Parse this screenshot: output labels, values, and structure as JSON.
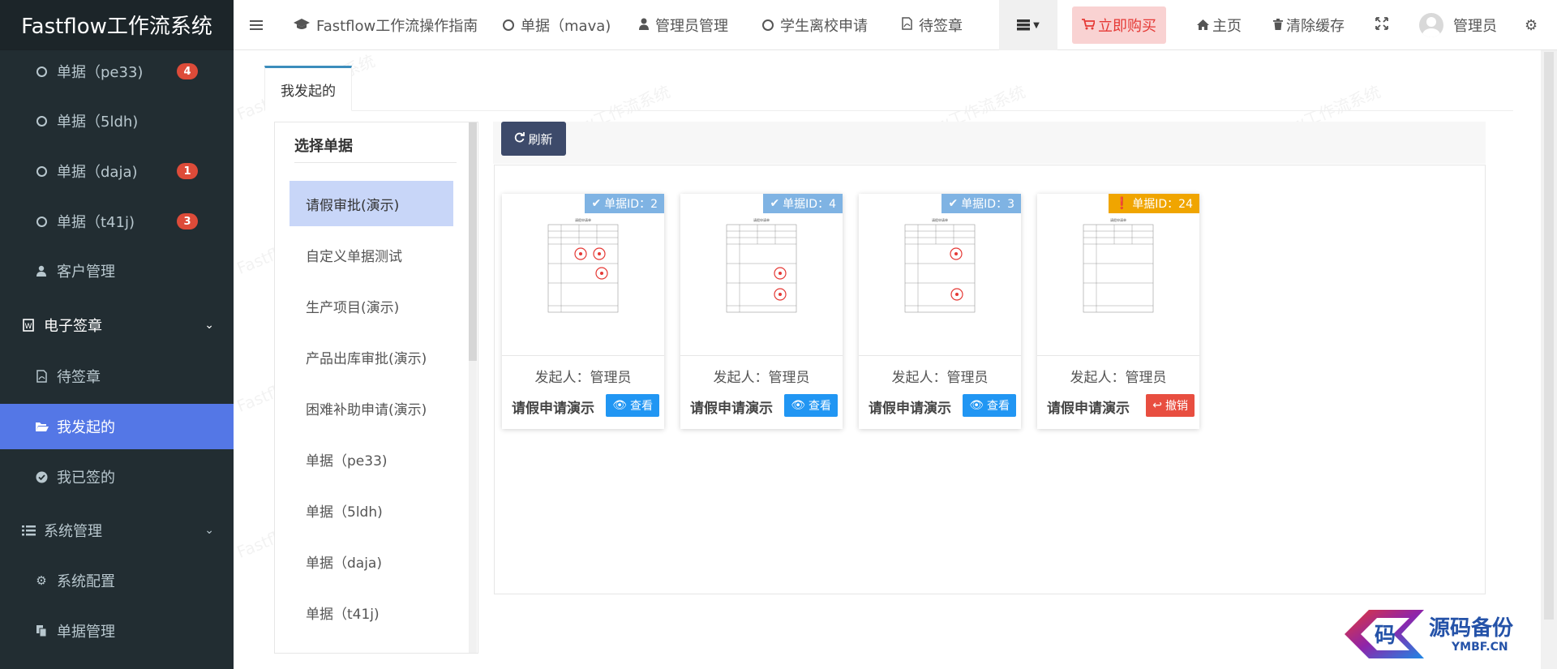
{
  "app": {
    "brand": "Fastflow工作流系统"
  },
  "sidebar": {
    "items": [
      {
        "label": "单据（pe33)",
        "badge": "4",
        "icon": "circle-icon"
      },
      {
        "label": "单据（5ldh)",
        "badge": "",
        "icon": "circle-icon"
      },
      {
        "label": "单据（daja)",
        "badge": "1",
        "icon": "circle-icon"
      },
      {
        "label": "单据（t41j)",
        "badge": "3",
        "icon": "circle-icon"
      },
      {
        "label": "客户管理",
        "icon": "user-icon"
      },
      {
        "label": "电子签章",
        "icon": "word-file-icon"
      },
      {
        "label": "待签章",
        "icon": "pdf-file-icon"
      },
      {
        "label": "我发起的",
        "icon": "folder-open-icon"
      },
      {
        "label": "我已签的",
        "icon": "check-circle-icon"
      },
      {
        "label": "系统管理",
        "icon": "list-icon"
      },
      {
        "label": "系统配置",
        "icon": "gear-icon"
      },
      {
        "label": "单据管理",
        "icon": "copy-icon"
      }
    ]
  },
  "topnav": {
    "guide": "Fastflow工作流操作指南",
    "mava": "单据（mava)",
    "admin_mgmt": "管理员管理",
    "leave_school": "学生离校申请",
    "pending_sign": "待签章",
    "buy": "立即购买",
    "home": "主页",
    "clear_cache": "清除缓存",
    "user": "管理员"
  },
  "tabs": {
    "active": "我发起的"
  },
  "left_panel": {
    "title": "选择单据",
    "categories": [
      "请假审批(演示)",
      "自定义单据测试",
      "生产项目(演示)",
      "产品出库审批(演示)",
      "困难补助申请(演示)",
      "单据（pe33)",
      "单据（5ldh)",
      "单据（daja)",
      "单据（t41j)"
    ]
  },
  "toolbar": {
    "refresh": "刷新"
  },
  "cards": [
    {
      "id_label": "单据ID：2",
      "starter": "发起人：管理员",
      "title": "请假申请演示",
      "action": "查看"
    },
    {
      "id_label": "单据ID：4",
      "starter": "发起人：管理员",
      "title": "请假申请演示",
      "action": "查看"
    },
    {
      "id_label": "单据ID：3",
      "starter": "发起人：管理员",
      "title": "请假申请演示",
      "action": "查看"
    },
    {
      "id_label": "单据ID：24",
      "starter": "发起人：管理员",
      "title": "请假申请演示",
      "action": "撤销"
    }
  ],
  "watermark": "Fastflow工作流系统",
  "logo": {
    "char": "码",
    "text": "源码备份",
    "sub": "YMBF.CN"
  },
  "colors": {
    "accent": "#5477e6",
    "sidebar_bg": "#222d32",
    "buy_bg": "#f9d2d2",
    "buy_text": "#e53935",
    "view_btn": "#2196f3",
    "revoke_btn": "#e84e40"
  }
}
